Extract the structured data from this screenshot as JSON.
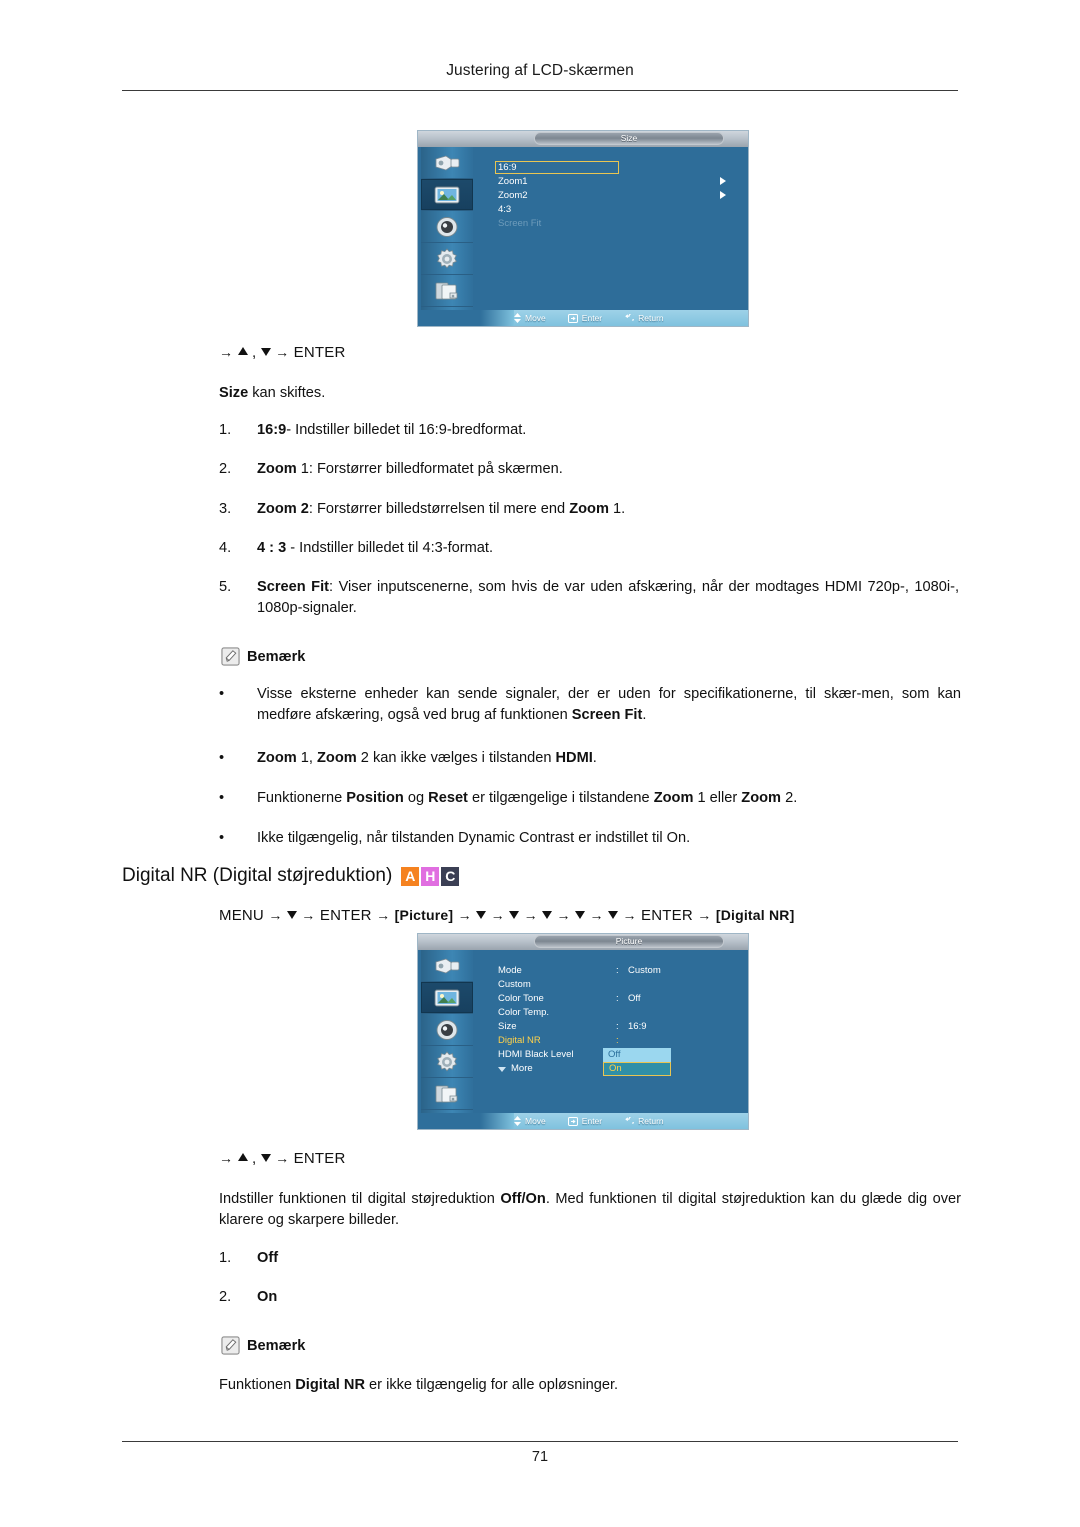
{
  "header": {
    "title": "Justering af LCD-skærmen"
  },
  "footer": {
    "page_number": "71"
  },
  "osd_size": {
    "title": "Size",
    "sidebar_icons": [
      "input-source-icon",
      "picture-icon",
      "sound-icon",
      "setup-gear-icon",
      "multi-control-icon"
    ],
    "rows": [
      {
        "label": "16:9",
        "selected": true,
        "arrow": false,
        "dim": false
      },
      {
        "label": "Zoom1",
        "selected": false,
        "arrow": true,
        "dim": false
      },
      {
        "label": "Zoom2",
        "selected": false,
        "arrow": true,
        "dim": false
      },
      {
        "label": "4:3",
        "selected": false,
        "arrow": false,
        "dim": false
      },
      {
        "label": "Screen Fit",
        "selected": false,
        "arrow": false,
        "dim": true
      }
    ],
    "bottom_bar": {
      "move": "Move",
      "enter": "Enter",
      "return": "Return"
    }
  },
  "osd_picture": {
    "title": "Picture",
    "sidebar_icons": [
      "input-source-icon",
      "picture-icon",
      "sound-icon",
      "setup-gear-icon",
      "multi-control-icon"
    ],
    "rows": [
      {
        "label": "Mode",
        "value": "Custom",
        "gold": false
      },
      {
        "label": "Custom",
        "value": "",
        "gold": false
      },
      {
        "label": "Color Tone",
        "value": "Off",
        "gold": false
      },
      {
        "label": "Color Temp.",
        "value": "",
        "gold": false
      },
      {
        "label": "Size",
        "value": "16:9",
        "gold": false
      },
      {
        "label": "Digital NR",
        "value": "",
        "gold": true
      },
      {
        "label": "HDMI Black Level",
        "value": "",
        "gold": false
      }
    ],
    "more_label": "More",
    "dropdown": {
      "off": "Off",
      "on": "On"
    },
    "bottom_bar": {
      "move": "Move",
      "enter": "Enter",
      "return": "Return"
    }
  },
  "section_size": {
    "nav": {
      "prefix": "→",
      "sep": ",",
      "enter_arrow": "→",
      "enter": "ENTER"
    },
    "intro_bold": "Size",
    "intro_rest": " kan skiftes.",
    "items": [
      {
        "num": "1.",
        "bold": "16:9",
        "rest": "- Indstiller billedet til 16:9-bredformat."
      },
      {
        "num": "2.",
        "bold": "Zoom",
        "rest": " 1: Forstørrer billedformatet på skærmen."
      },
      {
        "num": "3.",
        "bold": "Zoom 2",
        "rest": ": Forstørrer billedstørrelsen til mere end ",
        "bold2": "Zoom",
        "rest2": " 1."
      },
      {
        "num": "4.",
        "bold": "4 : 3",
        "rest": " - Indstiller billedet til 4:3-format."
      },
      {
        "num": "5.",
        "bold": "Screen Fit",
        "rest": ": Viser inputscenerne, som hvis de var uden afskæring, når der modtages HDMI 720p-, 1080i-, 1080p-signaler."
      }
    ],
    "note_label": "Bemærk",
    "bullets": [
      {
        "pre": "Visse eksterne enheder kan sende signaler, der er uden for specifikationerne, til skær-men, som kan medføre afskæring, også ved brug af funktionen ",
        "bold": "Screen Fit",
        "post": "."
      },
      {
        "pre": "",
        "bold": "Zoom",
        "post": " 1, ",
        "bold2": "Zoom",
        "post2": " 2 kan ikke vælges i tilstanden ",
        "bold3": "HDMI",
        "post3": "."
      },
      {
        "pre": "Funktionerne ",
        "bold": "Position",
        "post": " og ",
        "bold2": "Reset",
        "post2": " er tilgængelige i tilstandene ",
        "bold3": "Zoom",
        "post3": " 1 eller ",
        "bold4": "Zoom",
        "post4": " 2."
      },
      {
        "pre": "Ikke tilgængelig, når tilstanden Dynamic Contrast er indstillet til On.",
        "bold": "",
        "post": ""
      }
    ]
  },
  "section_digital_nr": {
    "heading": "Digital NR (Digital støjreduktion)",
    "badges": [
      {
        "letter": "A",
        "color": "#F58220"
      },
      {
        "letter": "H",
        "color": "#E06EE0"
      },
      {
        "letter": "C",
        "color": "#3B3F54"
      }
    ],
    "menu_path": {
      "menu": "MENU",
      "enter": "ENTER",
      "picture": "Picture",
      "enter2": "ENTER",
      "digital_nr": "Digital NR"
    },
    "nav": {
      "enter": "ENTER"
    },
    "body_pre": "Indstiller funktionen til digital støjreduktion ",
    "body_bold": "Off/On",
    "body_post": ". Med funktionen til digital støjreduktion kan du glæde dig over klarere og skarpere billeder.",
    "items": [
      {
        "num": "1.",
        "label": "Off"
      },
      {
        "num": "2.",
        "label": "On"
      }
    ],
    "note_label": "Bemærk",
    "note_pre": "Funktionen ",
    "note_bold": "Digital NR",
    "note_post": " er ikke tilgængelig for alle opløsninger."
  }
}
